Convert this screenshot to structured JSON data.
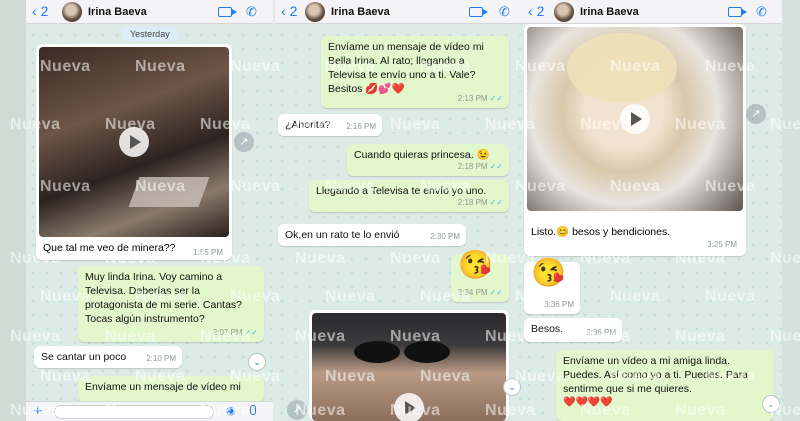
{
  "contact": {
    "name": "Irina Baeva",
    "back_count": "2"
  },
  "icons": {
    "back": "chevron-left-icon",
    "video": "video-call-icon",
    "call": "phone-icon",
    "share": "forward-icon",
    "play": "play-icon"
  },
  "colors": {
    "accent": "#1f7cf2",
    "incoming": "#ffffff",
    "outgoing": "#e2f7cb",
    "ticks": "#4fb6ec"
  },
  "watermark": "Nueva",
  "panel1": {
    "date_chip": "Yesterday",
    "video_caption": "Que tal me veo de minera??",
    "video_time": "1:55 PM",
    "msg1": {
      "text": "Muy linda Irina. Voy camino a Televisa. Deberías ser la protagonista de mi serie. Cantas? Tocas algún instrumento?",
      "time": "2:07 PM"
    },
    "msg2": {
      "text": "Se cantar un poco",
      "time": "2:10 PM"
    },
    "msg3": {
      "text": "Envíame un mensaje de vídeo mi"
    }
  },
  "panel2": {
    "msg1": {
      "text": "Envíame un mensaje de vídeo mi Bella Irina. Al rato; llegando a Televisa te envío uno a ti. Vale? Besitos 💋💕❤️",
      "time": "2:13 PM"
    },
    "msg2": {
      "text": "¿Ahorita?",
      "time": "2:16 PM"
    },
    "msg3": {
      "text": "Cuando quieras princesa. 😉",
      "time": "2:18 PM"
    },
    "msg4": {
      "text": "Llegando a Televisa te envío yo uno.",
      "time": "2:18 PM"
    },
    "msg5": {
      "text": "Ok,en un rato te lo envió",
      "time": "2:30 PM"
    },
    "msg6": {
      "text": "😘",
      "time": "2:34 PM"
    }
  },
  "panel3": {
    "msg1": {
      "text": "Listo.😊 besos y bendiciones.",
      "time": "3:25 PM"
    },
    "msg2": {
      "text": "😘",
      "time": "3:36 PM"
    },
    "msg3": {
      "text": "Besos.",
      "time": "3:36 PM"
    },
    "msg4": {
      "text": "Envíame un vídeo a mi amiga linda. Puedes. Así como yo a ti. Puedes. Para sentirme que si me quieres.",
      "hearts": "❤️❤️❤️❤️"
    }
  }
}
